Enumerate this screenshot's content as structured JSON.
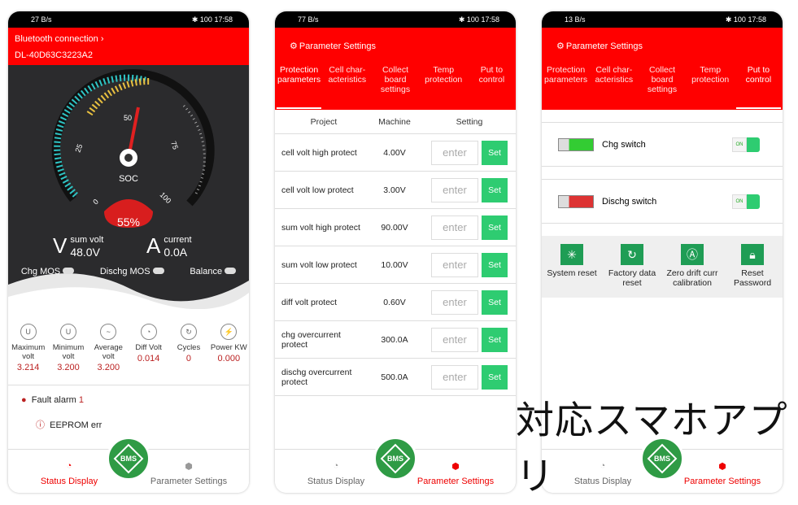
{
  "status_bars": [
    {
      "speed": "27",
      "unit": "B/s",
      "battery": "100",
      "time": "17:58"
    },
    {
      "speed": "77",
      "unit": "B/s",
      "battery": "100",
      "time": "17:58"
    },
    {
      "speed": "13",
      "unit": "B/s",
      "battery": "100",
      "time": "17:58"
    }
  ],
  "status_display": {
    "bluetooth_label": "Bluetooth connection",
    "chevron": "›",
    "device_id": "DL-40D63C3223A2",
    "gauge": {
      "ticks": [
        "0",
        "25",
        "50",
        "75",
        "100"
      ],
      "label": "SOC",
      "value": "55%",
      "percent": 55
    },
    "sum_volt_label": "sum volt",
    "sum_volt": "48.0V",
    "current_label": "current",
    "current": "0.0A",
    "toggles": [
      {
        "label": "Chg MOS",
        "on": false
      },
      {
        "label": "Dischg MOS",
        "on": false
      },
      {
        "label": "Balance",
        "on": false
      }
    ],
    "stats": [
      {
        "label": "Maximum volt",
        "value": "3.214",
        "icon": "voltage-up-icon"
      },
      {
        "label": "Minimum volt",
        "value": "3.200",
        "icon": "voltage-down-icon"
      },
      {
        "label": "Average volt",
        "value": "3.200",
        "icon": "wave-icon"
      },
      {
        "label": "Diff Volt",
        "value": "0.014",
        "icon": "gauge-icon"
      },
      {
        "label": "Cycles",
        "value": "0",
        "icon": "cycle-icon"
      },
      {
        "label": "Power KW",
        "value": "0.000",
        "icon": "power-icon"
      }
    ],
    "fault_label": "Fault alarm",
    "fault_count": "1",
    "fault_item": "EEPROM err"
  },
  "nav": {
    "status": "Status Display",
    "params": "Parameter Settings",
    "logo": "BMS"
  },
  "param": {
    "title": "Parameter Settings",
    "tabs": [
      "Protection parameters",
      "Cell char- acteristics",
      "Collect board settings",
      "Temp protection",
      "Put to control"
    ],
    "headers": [
      "Project",
      "Machine",
      "Setting"
    ],
    "rows": [
      {
        "name": "cell volt high protect",
        "value": "4.00V"
      },
      {
        "name": "cell volt low protect",
        "value": "3.00V"
      },
      {
        "name": "sum volt high protect",
        "value": "90.00V"
      },
      {
        "name": "sum volt low protect",
        "value": "10.00V"
      },
      {
        "name": "diff volt protect",
        "value": "0.60V"
      },
      {
        "name": "chg overcurrent protect",
        "value": "300.0A"
      },
      {
        "name": "dischg overcurrent protect",
        "value": "500.0A"
      }
    ],
    "placeholder": "enter",
    "set": "Set"
  },
  "control": {
    "switches": [
      {
        "label": "Chg switch",
        "state": "ON"
      },
      {
        "label": "Dischg switch",
        "state": "ON"
      }
    ],
    "buttons": [
      {
        "label": "System reset",
        "icon": "spinner-icon"
      },
      {
        "label": "Factory data reset",
        "icon": "refresh-icon"
      },
      {
        "label": "Zero drift curr calibration",
        "icon": "ampere-icon"
      },
      {
        "label": "Reset Password",
        "icon": "lock-icon"
      }
    ]
  },
  "caption": "対応スマホアプリ",
  "colors": {
    "header": "#ff0000",
    "accent_green": "#2ecc71",
    "dark_bg": "#2b2b2d"
  }
}
